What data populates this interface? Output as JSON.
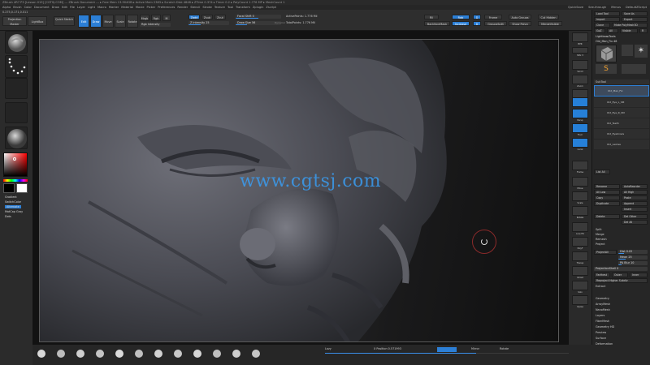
{
  "window": {
    "title": "ZBrush 4R7 P3 [Lesson 019] [CGTSJ.COM] --- ZBrush Document --- ▸ Free Mem 13.904GB ▸ Active Mem 2383 ▸ Scratch Disk 4848 ▸ ZTime 0.374 ▸ Timer 0.2 ▸ PolyCount 1.776 MP ▸ MeshCount 1"
  },
  "menubar": {
    "items": [
      "Alpha",
      "Brush",
      "Color",
      "Document",
      "Draw",
      "Edit",
      "File",
      "Layer",
      "Light",
      "Macro",
      "Marker",
      "Material",
      "Movie",
      "Picker",
      "Preferences",
      "Render",
      "Stencil",
      "Stroke",
      "Texture",
      "Tool",
      "Transform",
      "Zplugin",
      "Zscript"
    ],
    "right_items": [
      "QuickSave",
      "See-through",
      "Menus",
      "DefaultZScript"
    ]
  },
  "toolbar": {
    "coords": "0.275,0.171,0.011",
    "projection_master": "Projection Master",
    "lightbox": "LightBox",
    "quick_sketch": "Quick Sketch",
    "edit": "Edit",
    "draw": "Draw",
    "move": "Move",
    "scale": "Scale",
    "rotate": "Rotate",
    "mrgb": "Mrgb",
    "rgb": "Rgb",
    "m": "M",
    "zadd": "Zadd",
    "zsub": "Zsub",
    "zcut": "Zcut",
    "rgb_intensity": "Rgb Intensity",
    "z_intensity": "Z Intensity 25",
    "focal_shift": "Focal Shift 0",
    "draw_size": "Draw Size 56",
    "dynamic": "Dynamic",
    "active_points": "ActivePoints: 1.776 Mil",
    "total_points": "TotalPoints: 1.776 Mil",
    "fill": "Fill",
    "rgb_btn": "Rgb",
    "d": "D",
    "frame": "Frame",
    "auto_group": "Auto Groups",
    "cut_hidden": "Cut Hidden",
    "backface_mask": "BackfaceMask",
    "increase": "Increase",
    "polygroupit": "GroupsSplit",
    "show_polyg": "Show Polyg",
    "mergeVisible": "MergeVisible"
  },
  "left_tray": {
    "brush_label": "Standard",
    "stroke_label": "Dots",
    "gradient_label": "Gradient",
    "switch_color": "SwitchColor",
    "alternate": "Alternate",
    "matcap": "MatCap Gray",
    "color_fg": "#000000",
    "color_bg": "#ffffff"
  },
  "right_tray": {
    "buttons": [
      "BPR",
      "SPix 3",
      "Scroll",
      "Zoom",
      "Actual",
      "AAHalf",
      "Persp",
      "Floor",
      "Local",
      "L.Sym",
      "Frame",
      "Move",
      "Scale",
      "Rotate",
      "Line Fill",
      "PolyF",
      "Transp",
      "Ghost",
      "Solo",
      "Xpose"
    ]
  },
  "palette": {
    "header": "Lightbox▸Tools",
    "load_tool": "Load Tool",
    "save_as": "Save As",
    "import": "Import",
    "export": "Export",
    "clone": "Clone",
    "make_polymesh": "Make PolyMesh3D",
    "goz": "GoZ",
    "all": "All",
    "visible": "Visible",
    "r": "R",
    "current_tool": "Old_Man_Fix 48",
    "subtools_title": "SubTool",
    "subtools": [
      "Old_Man_Fix",
      "Old_Eye_L_SM",
      "Old_Eye_R_SM",
      "Old_Teeth",
      "Old_Eyebrows",
      "Old_Lashes"
    ],
    "list_all": "List All",
    "rename": "Rename",
    "auto_reorder": "AutoReorder",
    "all_low": "All Low",
    "all_high": "All High",
    "copy": "Copy",
    "paste": "Paste",
    "duplicate": "Duplicate",
    "append": "Append",
    "insert": "Insert",
    "delete": "Delete",
    "del_other": "Del Other",
    "del_all": "Del All",
    "split": "Split",
    "merge": "Merge",
    "remesh": "Remesh",
    "project": "Project",
    "project_all": "ProjectAll",
    "dist": "Dist 0.02",
    "mean": "Mean 25",
    "pa_blur": "PA Blur 10",
    "project_shell": "ProjectionShell 0",
    "farthest": "Farthest",
    "outer": "Outer",
    "inner": "Inner",
    "reproject": "Reproject Higher Subdiv",
    "extract": "Extract",
    "sections": [
      "Geometry",
      "ArrayMesh",
      "NanoMesh",
      "Layers",
      "FiberMesh",
      "Geometry HD",
      "Preview",
      "Surface",
      "Deformation",
      "Masking"
    ]
  },
  "bottom": {
    "left_label": "Lazy",
    "position": "X Position 0.571993",
    "mirror": "Mirror",
    "rotate": "Rotate",
    "progress": 0.62
  },
  "canvas": {
    "watermark": "www.cgtsj.com"
  },
  "colors": {
    "accent": "#2c7fd6",
    "watermark": "#3a9cf0"
  }
}
